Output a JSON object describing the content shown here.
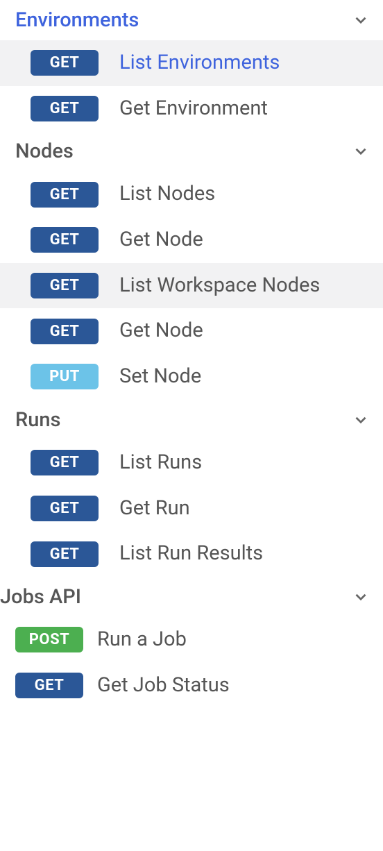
{
  "sections": [
    {
      "title": "Environments",
      "active": true,
      "items": [
        {
          "method": "GET",
          "label": "List Environments",
          "active": true,
          "highlight": true
        },
        {
          "method": "GET",
          "label": "Get Environment",
          "active": false,
          "highlight": false
        }
      ]
    },
    {
      "title": "Nodes",
      "active": false,
      "items": [
        {
          "method": "GET",
          "label": "List Nodes",
          "active": false,
          "highlight": false
        },
        {
          "method": "GET",
          "label": "Get Node",
          "active": false,
          "highlight": false
        },
        {
          "method": "GET",
          "label": "List Workspace Nodes",
          "active": false,
          "highlight": true
        },
        {
          "method": "GET",
          "label": "Get Node",
          "active": false,
          "highlight": false
        },
        {
          "method": "PUT",
          "label": "Set Node",
          "active": false,
          "highlight": false
        }
      ]
    },
    {
      "title": "Runs",
      "active": false,
      "items": [
        {
          "method": "GET",
          "label": "List Runs",
          "active": false,
          "highlight": false
        },
        {
          "method": "GET",
          "label": "Get Run",
          "active": false,
          "highlight": false
        },
        {
          "method": "GET",
          "label": "List Run Results",
          "active": false,
          "highlight": false
        }
      ]
    },
    {
      "title": "Jobs API",
      "active": false,
      "items": [
        {
          "method": "POST",
          "label": "Run a Job",
          "active": false,
          "highlight": false
        },
        {
          "method": "GET",
          "label": "Get Job Status",
          "active": false,
          "highlight": false
        }
      ]
    }
  ]
}
